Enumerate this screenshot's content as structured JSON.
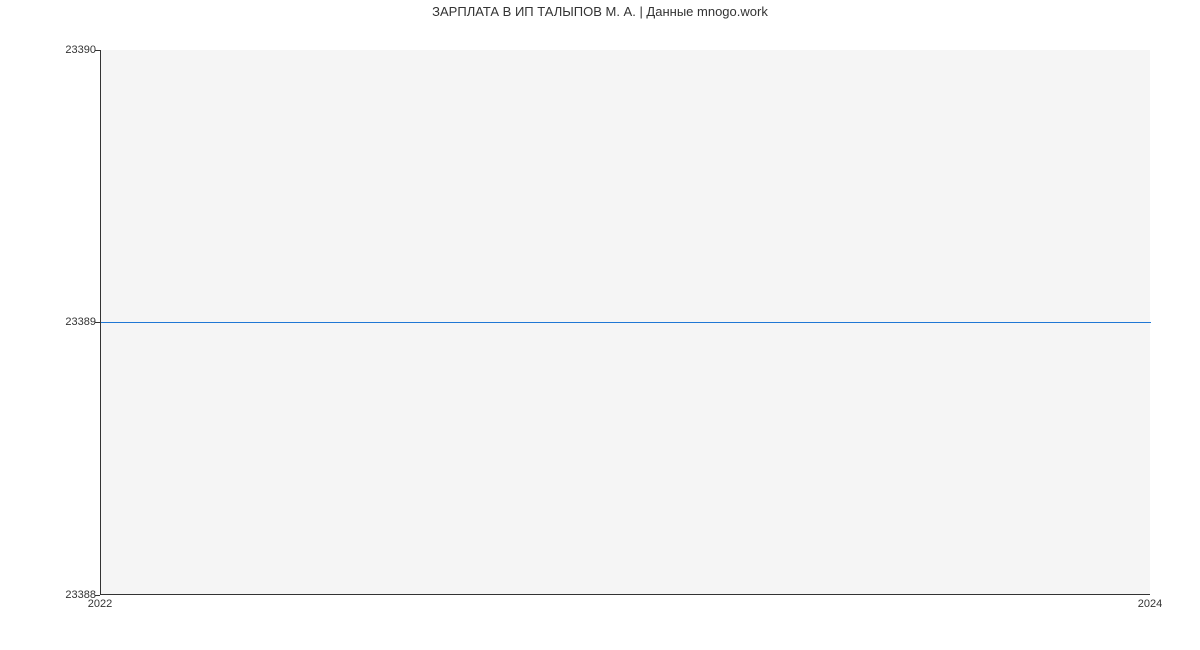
{
  "chart_data": {
    "type": "line",
    "title": "ЗАРПЛАТА В ИП ТАЛЫПОВ М. А. | Данные mnogo.work",
    "xlabel": "",
    "ylabel": "",
    "x": [
      2022,
      2024
    ],
    "values": [
      23389,
      23389
    ],
    "y_ticks": [
      23388,
      23389,
      23390
    ],
    "x_ticks": [
      2022,
      2024
    ],
    "ylim": [
      23388,
      23390
    ],
    "xlim": [
      2022,
      2024
    ]
  }
}
